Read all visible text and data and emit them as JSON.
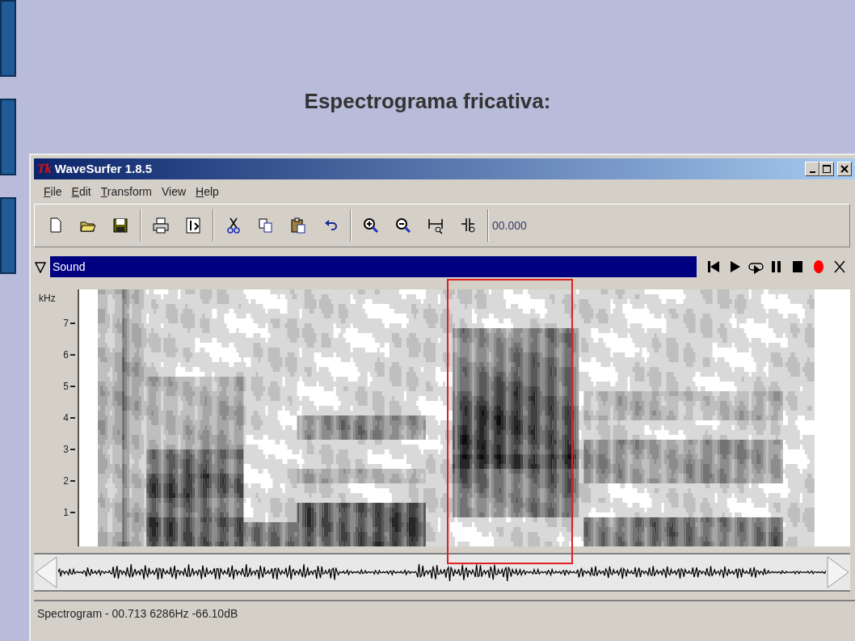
{
  "slide": {
    "title": "Espectrograma fricativa:"
  },
  "window": {
    "logo": "Tk",
    "title": "WaveSurfer 1.8.5"
  },
  "menu": [
    {
      "label": "File",
      "underlined": true
    },
    {
      "label": "Edit",
      "underlined": true
    },
    {
      "label": "Transform",
      "underlined": true
    },
    {
      "label": "View",
      "underlined": false
    },
    {
      "label": "Help",
      "underlined": true
    }
  ],
  "toolbar": {
    "groups": [
      [
        {
          "kind": "new"
        },
        {
          "kind": "open"
        },
        {
          "kind": "save"
        }
      ],
      [
        {
          "kind": "print"
        },
        {
          "kind": "properties"
        }
      ],
      [
        {
          "kind": "cut"
        },
        {
          "kind": "copy"
        },
        {
          "kind": "paste"
        },
        {
          "kind": "undo"
        }
      ],
      [
        {
          "kind": "zoom-in"
        },
        {
          "kind": "zoom-out"
        },
        {
          "kind": "zoom-all"
        },
        {
          "kind": "zoom-selection"
        }
      ]
    ],
    "time": "00.000"
  },
  "sound_panel": {
    "title": "Sound",
    "expanded": true,
    "controls": [
      {
        "kind": "rewind"
      },
      {
        "kind": "play"
      },
      {
        "kind": "loop"
      },
      {
        "kind": "pause"
      },
      {
        "kind": "stop"
      },
      {
        "kind": "record"
      },
      {
        "kind": "close"
      }
    ]
  },
  "spectrogram": {
    "unit": "kHz",
    "ticks": [
      "7",
      "6",
      "5",
      "4",
      "3",
      "2",
      "1"
    ]
  },
  "status_bar": "Spectrogram - 00.713 6286Hz -66.10dB"
}
